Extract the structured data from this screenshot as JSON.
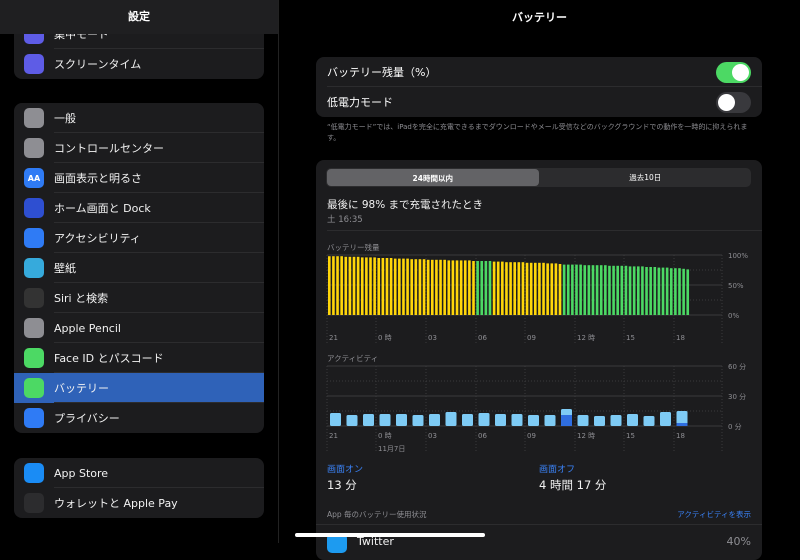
{
  "sidebar": {
    "title": "設定",
    "group1": [
      {
        "label": "集中モード",
        "icon": "moon-icon",
        "color": "#5e5ce6"
      },
      {
        "label": "スクリーンタイム",
        "icon": "hourglass-icon",
        "color": "#5e5ce6"
      }
    ],
    "group2": [
      {
        "label": "一般",
        "icon": "gear-icon",
        "color": "#8e8e93"
      },
      {
        "label": "コントロールセンター",
        "icon": "toggles-icon",
        "color": "#8e8e93"
      },
      {
        "label": "画面表示と明るさ",
        "icon": "text-size-icon",
        "color": "#2f7bf5",
        "glyph": "AA"
      },
      {
        "label": "ホーム画面と Dock",
        "icon": "home-grid-icon",
        "color": "#2e4fd1"
      },
      {
        "label": "アクセシビリティ",
        "icon": "accessibility-icon",
        "color": "#2f7bf5"
      },
      {
        "label": "壁紙",
        "icon": "flower-icon",
        "color": "#36aadc"
      },
      {
        "label": "Siri と検索",
        "icon": "siri-icon",
        "color": "#333"
      },
      {
        "label": "Apple Pencil",
        "icon": "pencil-icon",
        "color": "#8e8e93"
      },
      {
        "label": "Face ID とパスコード",
        "icon": "face-id-icon",
        "color": "#4cd964"
      },
      {
        "label": "バッテリー",
        "icon": "battery-icon",
        "color": "#4cd964",
        "selected": true
      },
      {
        "label": "プライバシー",
        "icon": "hand-icon",
        "color": "#2f7bf5"
      }
    ],
    "group3": [
      {
        "label": "App Store",
        "icon": "app-store-icon",
        "color": "#1a8cf5"
      },
      {
        "label": "ウォレットと Apple Pay",
        "icon": "wallet-icon",
        "color": "#2c2c2e"
      }
    ]
  },
  "main": {
    "title": "バッテリー",
    "battery_percentage": {
      "label": "バッテリー残量（%）",
      "on": true
    },
    "low_power_mode": {
      "label": "低電力モード",
      "on": false
    },
    "footnote": "“低電力モード”では、iPadを完全に充電できるまでダウンロードやメール受信などのバックグラウンドでの動作を一時的に抑えられます。",
    "tabs": [
      "24時間以内",
      "過去10日"
    ],
    "active_tab": 0,
    "last_charge": "最後に 98% まで充電されたとき",
    "last_charge_time": "土 16:35",
    "screen_on_label": "画面オン",
    "screen_on_value": "13 分",
    "screen_off_label": "画面オフ",
    "screen_off_value": "4 時間 17 分",
    "app_usage_label": "App 毎のバッテリー使用状況",
    "show_activity_link": "アクティビティを表示",
    "apps": [
      {
        "name": "Twitter",
        "percent": "40%"
      }
    ],
    "colors": {
      "normal": "#4cd964",
      "low_power": "#ffd60a",
      "screen_on": "#2f6ee0",
      "screen_off": "#7ecbf5",
      "accent": "#3a82f7"
    }
  },
  "chart_data": [
    {
      "type": "bar",
      "title": "バッテリー残量",
      "x_tick_labels": [
        "21",
        "0 時",
        "03",
        "06",
        "09",
        "12 時",
        "15",
        "18"
      ],
      "y_tick_labels": [
        "100%",
        "50%",
        "0%"
      ],
      "ylim": [
        0,
        100
      ],
      "grid": true,
      "values": [
        98,
        98,
        98,
        98,
        97,
        97,
        97,
        97,
        96,
        96,
        96,
        96,
        95,
        95,
        95,
        95,
        94,
        94,
        94,
        94,
        93,
        93,
        93,
        93,
        92,
        92,
        92,
        92,
        92,
        91,
        91,
        91,
        91,
        91,
        91,
        90,
        90,
        90,
        90,
        90,
        89,
        89,
        89,
        88,
        88,
        88,
        88,
        88,
        87,
        87,
        87,
        87,
        87,
        86,
        86,
        86,
        85,
        84,
        84,
        84,
        84,
        84,
        83,
        83,
        83,
        83,
        83,
        83,
        82,
        82,
        82,
        82,
        82,
        81,
        81,
        81,
        81,
        80,
        80,
        80,
        79,
        79,
        79,
        78,
        78,
        78,
        77,
        76
      ],
      "low_power_ranges": [
        [
          0,
          35
        ],
        [
          40,
          56
        ]
      ]
    },
    {
      "type": "bar",
      "title": "アクティビティ",
      "x_tick_labels": [
        "21",
        "0 時",
        "03",
        "06",
        "09",
        "12 時",
        "15",
        "18"
      ],
      "date_label": "11月7日",
      "y_tick_labels": [
        "60 分",
        "30 分",
        "0 分"
      ],
      "ylim": [
        0,
        60
      ],
      "grid": true,
      "series": [
        {
          "name": "画面オン",
          "values": [
            0,
            0,
            0,
            0,
            0,
            0,
            0,
            0,
            0,
            0,
            0,
            0,
            0,
            0,
            11,
            0,
            0,
            0,
            0,
            0,
            0,
            3
          ]
        },
        {
          "name": "画面オフ",
          "values": [
            13,
            11,
            12,
            12,
            12,
            11,
            12,
            14,
            12,
            13,
            12,
            12,
            11,
            11,
            6,
            11,
            10,
            11,
            12,
            10,
            14,
            12
          ]
        }
      ]
    }
  ]
}
